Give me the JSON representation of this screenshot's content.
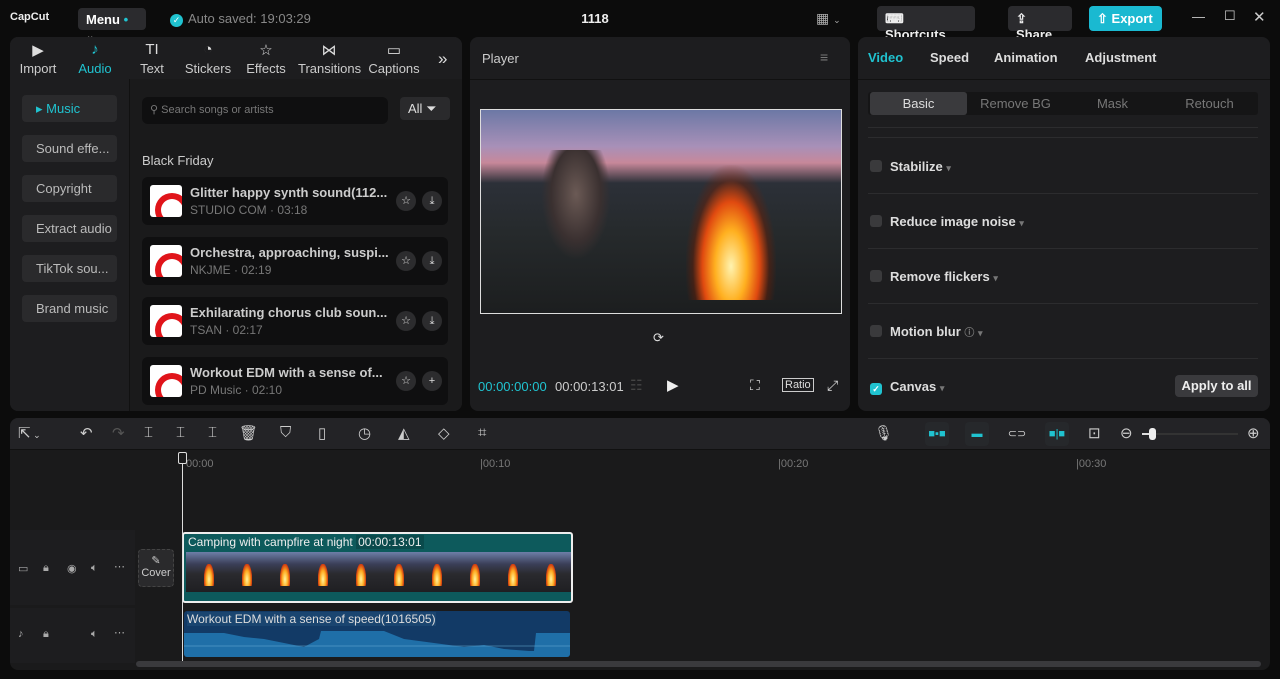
{
  "titlebar": {
    "logo": "CapCut",
    "menu": "Menu",
    "autosave": "Auto saved: 19:03:29",
    "project": "1118",
    "shortcuts": "Shortcuts",
    "share": "Share",
    "export": "Export"
  },
  "tabs": [
    {
      "icon": "▶",
      "label": "Import"
    },
    {
      "icon": "♪",
      "label": "Audio"
    },
    {
      "icon": "TI",
      "label": "Text"
    },
    {
      "icon": "◔",
      "label": "Stickers"
    },
    {
      "icon": "☆",
      "label": "Effects"
    },
    {
      "icon": "⋈",
      "label": "Transitions"
    },
    {
      "icon": "▭",
      "label": "Captions"
    }
  ],
  "audio_sidebar": [
    "▸ Music",
    "Sound effe...",
    "Copyright",
    "Extract audio",
    "TikTok sou...",
    "Brand music"
  ],
  "search": {
    "placeholder": "Search songs or artists",
    "filter": "All"
  },
  "section": "Black Friday",
  "songs": [
    {
      "title": "Glitter happy synth sound(112...",
      "meta": "STUDIO COM · 03:18",
      "action": "⤓"
    },
    {
      "title": "Orchestra, approaching, suspi...",
      "meta": "NKJME · 02:19",
      "action": "⤓"
    },
    {
      "title": "Exhilarating chorus club soun...",
      "meta": "TSAN · 02:17",
      "action": "⤓"
    },
    {
      "title": "Workout EDM with a sense of...",
      "meta": "PD Music · 02:10",
      "action": "+"
    }
  ],
  "player": {
    "title": "Player",
    "current": "00:00:00:00",
    "total": "00:00:13:01",
    "ratio": "Ratio"
  },
  "props": {
    "tabs": [
      "Video",
      "Speed",
      "Animation",
      "Adjustment"
    ],
    "subtabs": [
      "Basic",
      "Remove BG",
      "Mask",
      "Retouch"
    ],
    "options": [
      "Stabilize",
      "Reduce image noise",
      "Remove flickers",
      "Motion blur",
      "Canvas"
    ],
    "apply": "Apply to all"
  },
  "timeline": {
    "ticks": [
      "00:00",
      "|00:10",
      "|00:20",
      "|00:30"
    ],
    "cover": "Cover",
    "video_clip": {
      "name": "Camping with campfire at night",
      "duration": "00:00:13:01"
    },
    "audio_clip": {
      "name": "Workout EDM with a sense of speed(1016505)"
    },
    "zoom_level": 0.03
  },
  "colors": {
    "accent": "#20c3d0",
    "export": "#1ab9d1"
  }
}
